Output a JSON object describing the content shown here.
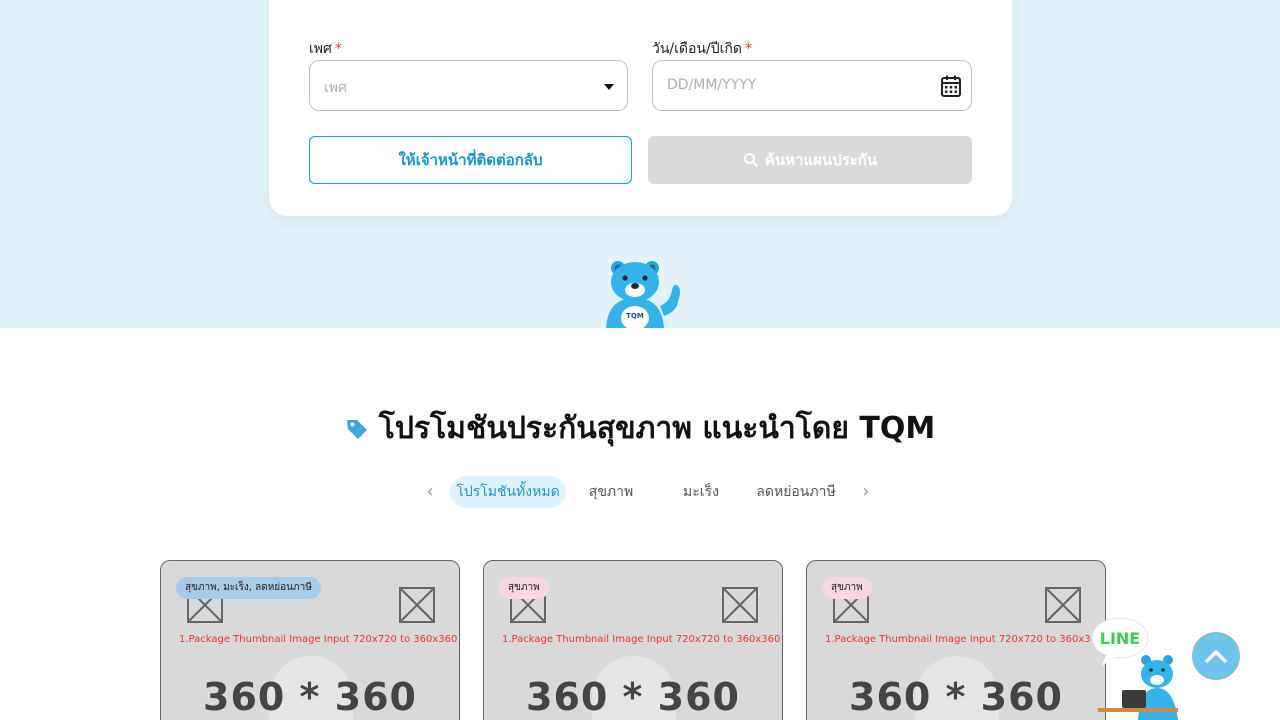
{
  "form": {
    "gender_label": "เพศ",
    "gender_required": "*",
    "gender_placeholder": "เพศ",
    "dob_label": "วัน/เดือน/ปีเกิด",
    "dob_required": "*",
    "dob_placeholder": "DD/MM/YYYY",
    "contact_button": "ให้เจ้าหน้าที่ติดต่อกลับ",
    "search_button": "ค้นหาแผนประกัน"
  },
  "section": {
    "title": "โปรโมชันประกันสุขภาพ แนะนำโดย TQM"
  },
  "tabs": [
    {
      "label": "โปรโมชันทั้งหมด",
      "active": true
    },
    {
      "label": "สุขภาพ",
      "active": false
    },
    {
      "label": "มะเร็ง",
      "active": false
    },
    {
      "label": "ลดหย่อนภาษี",
      "active": false
    }
  ],
  "cards": [
    {
      "badge": "สุขภาพ, มะเร็ง, ลดหย่อนภาษี",
      "thumb_text": "1.Package Thumbnail Image    Input  720x720  to 360x360",
      "size_text": "360 * 360"
    },
    {
      "badge": "สุขภาพ",
      "thumb_text": "1.Package Thumbnail Image    Input  720x720  to 360x360",
      "size_text": "360 * 360"
    },
    {
      "badge": "สุขภาพ",
      "thumb_text": "1.Package Thumbnail Image    Input  720x720  to 360x360",
      "size_text": "360 * 360"
    }
  ],
  "widgets": {
    "line_label": "LINE",
    "mascot_badge": "TQM"
  },
  "colors": {
    "accent": "#1596cd",
    "hero_bg": "#e3f3fb",
    "required": "#e53935",
    "line_green": "#3acd4f"
  }
}
